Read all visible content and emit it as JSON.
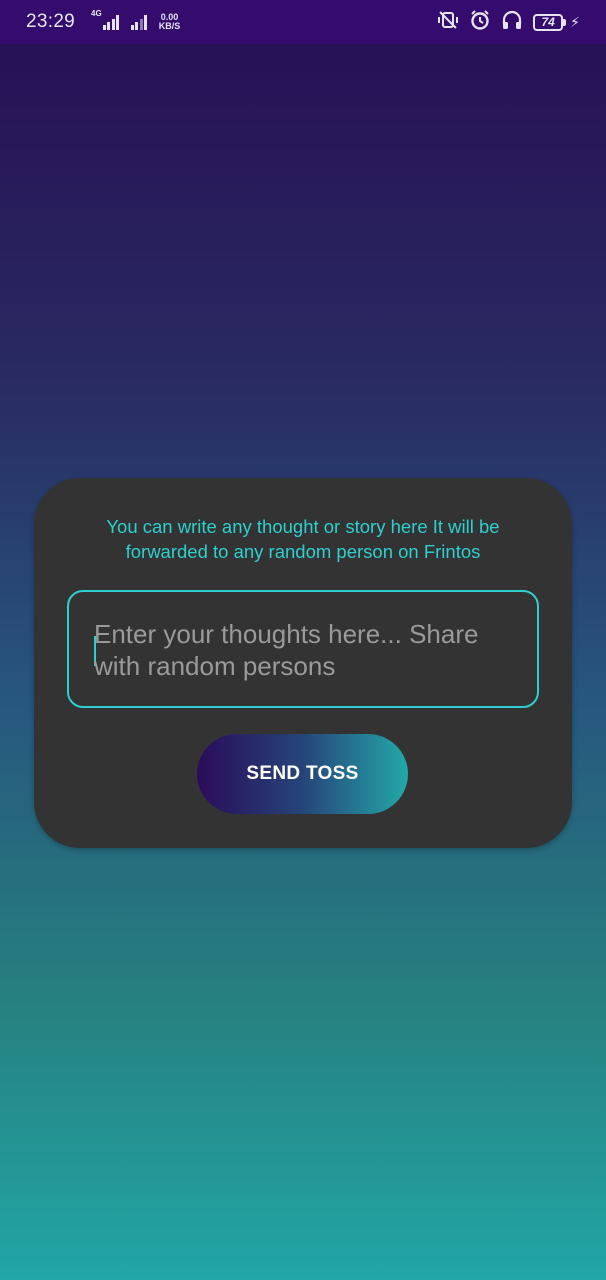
{
  "status_bar": {
    "time": "23:29",
    "network_type": "4G",
    "speed_value": "0.00",
    "speed_unit": "KB/S",
    "battery": "74",
    "icons": [
      "vibrate-off-icon",
      "alarm-icon",
      "headphones-icon",
      "battery-icon",
      "charging-icon"
    ]
  },
  "card": {
    "description": "You can write any thought or story here It will be forwarded to any random person on Frintos",
    "input_placeholder": "Enter your thoughts here... Share with random persons",
    "input_value": "",
    "send_button_label": "SEND TOSS"
  },
  "colors": {
    "accent": "#2ecfcf",
    "card_bg": "#333333",
    "status_bar": "#330c6e",
    "gradient_top": "#270d55",
    "gradient_bottom": "#22a6a6"
  }
}
